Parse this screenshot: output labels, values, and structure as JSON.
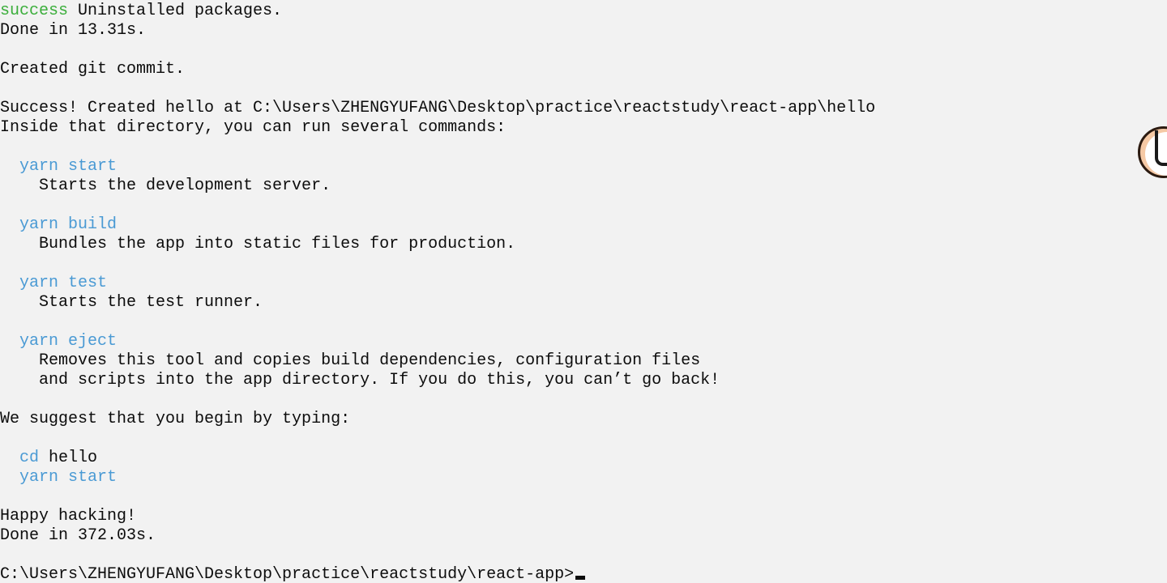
{
  "terminal": {
    "lines": [
      {
        "prefix": "success",
        "text": " Uninstalled packages."
      },
      {
        "text": "Done in 13.31s."
      },
      {
        "text": ""
      },
      {
        "text": "Created git commit."
      },
      {
        "text": ""
      },
      {
        "text": "Success! Created hello at C:\\Users\\ZHENGYUFANG\\Desktop\\practice\\reactstudy\\react-app\\hello"
      },
      {
        "text": "Inside that directory, you can run several commands:"
      },
      {
        "text": ""
      },
      {
        "cmd": "yarn start"
      },
      {
        "text": "    Starts the development server."
      },
      {
        "text": ""
      },
      {
        "cmd": "yarn build"
      },
      {
        "text": "    Bundles the app into static files for production."
      },
      {
        "text": ""
      },
      {
        "cmd": "yarn test"
      },
      {
        "text": "    Starts the test runner."
      },
      {
        "text": ""
      },
      {
        "cmd": "yarn eject"
      },
      {
        "text": "    Removes this tool and copies build dependencies, configuration files"
      },
      {
        "text": "    and scripts into the app directory. If you do this, you can’t go back!"
      },
      {
        "text": ""
      },
      {
        "text": "We suggest that you begin by typing:"
      },
      {
        "text": ""
      },
      {
        "cmd": "cd",
        "arg": " hello"
      },
      {
        "cmd": "yarn start"
      },
      {
        "text": ""
      },
      {
        "text": "Happy hacking!"
      },
      {
        "text": "Done in 372.03s."
      },
      {
        "text": ""
      }
    ],
    "prompt": "C:\\Users\\ZHENGYUFANG\\Desktop\\practice\\reactstudy\\react-app>"
  },
  "widget": {
    "icon": "floating-assistant-icon"
  },
  "colors": {
    "background": "#f2f2f2",
    "text": "#0c0c0c",
    "success": "#3bae3b",
    "command": "#4a9ad4"
  }
}
